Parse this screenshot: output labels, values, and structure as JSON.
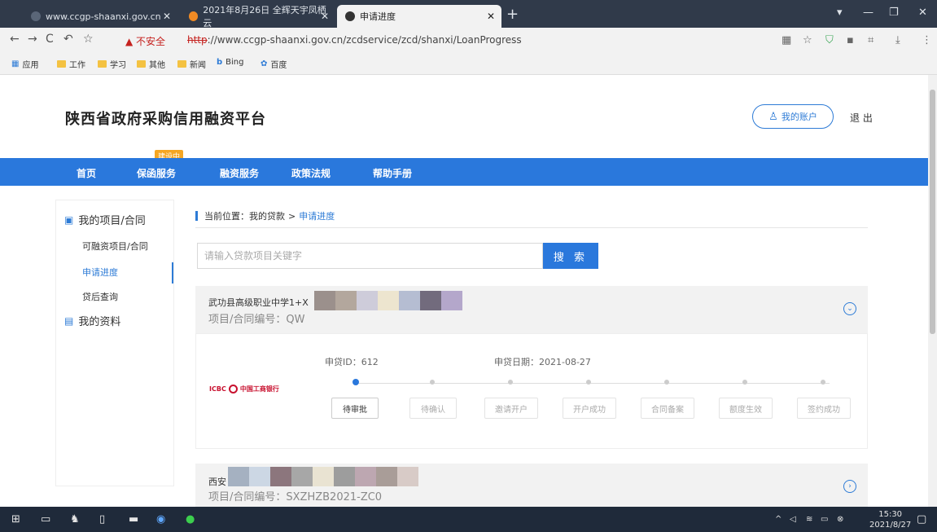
{
  "browser": {
    "tabs": [
      {
        "title": "www.ccgp-shaanxi.gov.cn",
        "active": false
      },
      {
        "title": "2021年8月26日 全辉天宇凤栖云",
        "active": false
      },
      {
        "title": "申请进度",
        "active": true
      }
    ],
    "new_tab": "+",
    "insecure_label": "▲ 不安全",
    "url_protocol": "http",
    "url_rest": "://www.ccgp-shaanxi.gov.cn/zcdservice/zcd/shanxi/LoanProgress",
    "bookmarks": [
      "应用",
      "工作",
      "学习",
      "其他",
      "新闻",
      "Bing",
      "百度"
    ]
  },
  "site": {
    "title": "陕西省政府采购信用融资平台",
    "account_label": "我的账户",
    "logout_label": "退 出",
    "nav": [
      "首页",
      "保函服务",
      "融资服务",
      "政策法规",
      "帮助手册"
    ],
    "nav_badge": "建设中"
  },
  "sidebar": {
    "group1": "我的项目/合同",
    "items": [
      "可融资项目/合同",
      "申请进度",
      "贷后查询"
    ],
    "active_index": 1,
    "group2": "我的资料"
  },
  "main": {
    "breadcrumb_prefix": "当前位置：我的贷款",
    "breadcrumb_sep": ">",
    "breadcrumb_current": "申请进度",
    "search_placeholder": "请输入贷款项目关键字",
    "search_button": "搜 索",
    "card1": {
      "name": "武功县高级职业中学1+X",
      "code": "项目/合同编号：QW",
      "apply_id": "申贷ID：612",
      "apply_date": "申贷日期：2021-08-27",
      "bank": "中国工商银行",
      "bank_prefix": "ICBC",
      "steps": [
        "待审批",
        "待确认",
        "邀请开户",
        "开户成功",
        "合同备案",
        "额度生效",
        "签约成功"
      ],
      "active_step": 0
    },
    "card2": {
      "name": "西安",
      "code": "项目/合同编号：SXZHZB2021-ZC0"
    }
  },
  "taskbar": {
    "time": "15:30",
    "date": "2021/8/27"
  },
  "colors": {
    "brand_blue": "#2a78dc",
    "badge_orange": "#f5a623",
    "insecure_red": "#c5221f"
  }
}
